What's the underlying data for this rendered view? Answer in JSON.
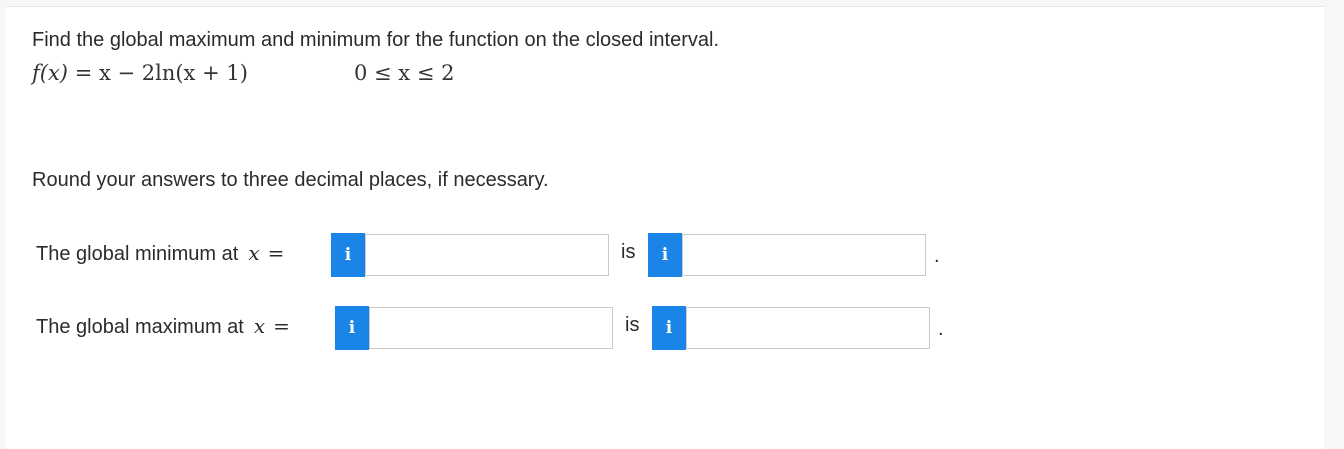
{
  "question": {
    "prompt": "Find the global maximum and minimum for the function on the closed interval.",
    "function_lhs": "f(x)",
    "function_rhs": "= x − 2ln(x + 1)",
    "interval": "0 ≤ x ≤ 2",
    "rounding_note": "Round your answers to three decimal places, if necessary."
  },
  "rows": [
    {
      "label": "The global minimum at",
      "var": "x",
      "eq": "=",
      "info_glyph": "i",
      "is_label": "is",
      "x_value": "",
      "y_value": "",
      "period": "."
    },
    {
      "label": "The global maximum at",
      "var": "x",
      "eq": "=",
      "info_glyph": "i",
      "is_label": "is",
      "x_value": "",
      "y_value": "",
      "period": "."
    }
  ],
  "colors": {
    "info_button": "#1a85e6",
    "text": "#2b2b2b"
  }
}
